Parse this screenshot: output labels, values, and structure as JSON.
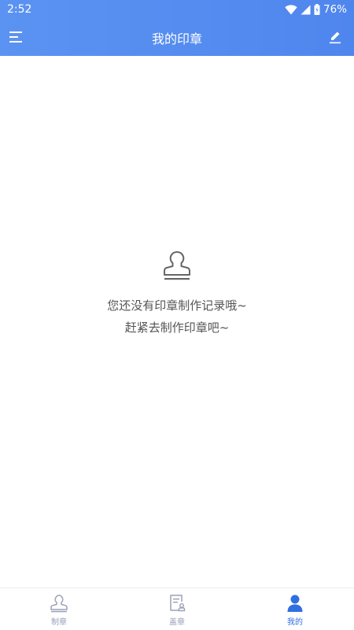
{
  "status_bar": {
    "time": "2:52",
    "battery": "76%",
    "icons": [
      "wifi-icon",
      "signal-icon",
      "battery-icon"
    ]
  },
  "header": {
    "title": "我的印章",
    "left_icon": "menu-icon",
    "right_icon": "edit-icon"
  },
  "empty_state": {
    "icon": "stamp-icon",
    "line1": "您还没有印章制作记录哦~",
    "line2": "赶紧去制作印章吧~"
  },
  "tabs": [
    {
      "label": "制章",
      "icon": "stamp-icon",
      "active": false
    },
    {
      "label": "盖章",
      "icon": "document-stamp-icon",
      "active": false
    },
    {
      "label": "我的",
      "icon": "user-icon",
      "active": true
    }
  ],
  "colors": {
    "header_start": "#5b93f2",
    "header_end": "#4f86ee",
    "active_tab": "#2f6fe0",
    "inactive_tab": "#9aa0b8"
  }
}
